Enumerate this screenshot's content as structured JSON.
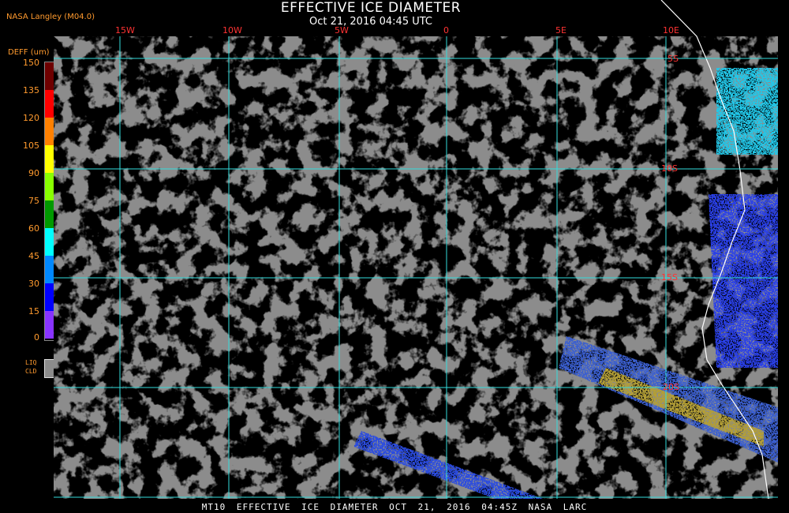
{
  "header": {
    "title": "EFFECTIVE ICE DIAMETER",
    "subtitle": "Oct 21, 2016 04:45 UTC",
    "source": "NASA Langley (M04.0)"
  },
  "legend": {
    "title": "DEFF (um)",
    "ticks": [
      "150",
      "135",
      "120",
      "105",
      "90",
      "75",
      "60",
      "45",
      "30",
      "15",
      "0"
    ],
    "colors": [
      "#6e0000",
      "#ff0000",
      "#ff8000",
      "#ffff00",
      "#88ff00",
      "#009900",
      "#00ffff",
      "#0088ff",
      "#0000ff",
      "#8833ff"
    ],
    "liquid_label_1": "LIQ",
    "liquid_label_2": "CLD",
    "liquid_color": "#8c8c8c"
  },
  "map": {
    "lon_labels": [
      "15W",
      "10W",
      "5W",
      "0",
      "5E",
      "10E"
    ],
    "lat_labels": [
      "5S",
      "10S",
      "15S",
      "20S"
    ],
    "grid_color": "#33dddd",
    "label_color": "#ff3333",
    "coast_color": "#ffffff"
  },
  "footer": {
    "text": "MT10  EFFECTIVE ICE DIAMETER  OCT 21, 2016 04:45Z  NASA LARC"
  }
}
